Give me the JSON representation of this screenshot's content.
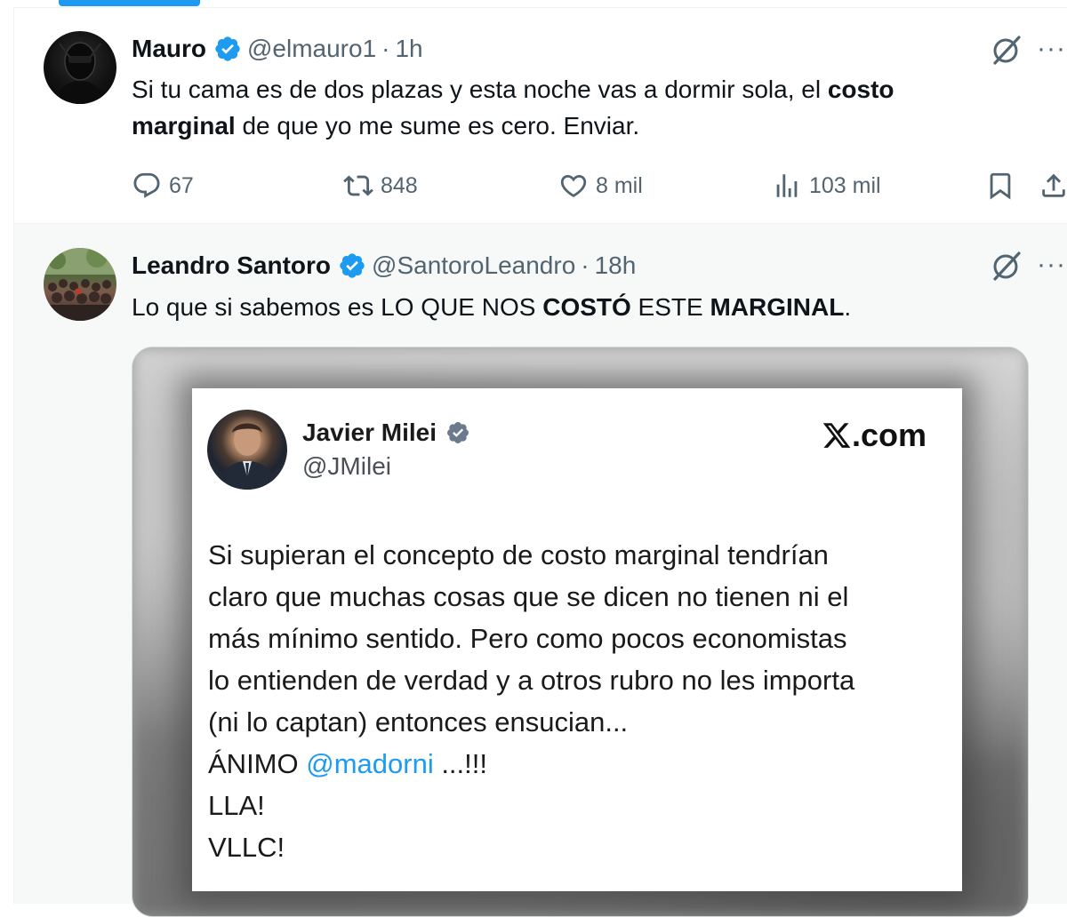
{
  "accent": "#1d9bf0",
  "tweets": [
    {
      "name": "Mauro",
      "handle": "@elmauro1",
      "time": "1h",
      "text_parts": [
        {
          "t": "Si tu cama es de dos plazas y esta noche vas a dormir sola, el ",
          "b": false
        },
        {
          "t": "costo marginal",
          "b": true
        },
        {
          "t": " de que yo me sume es cero. Enviar.",
          "b": false
        }
      ],
      "actions": {
        "replies": "67",
        "reposts": "848",
        "likes": "8 mil",
        "views": "103 mil"
      }
    },
    {
      "name": "Leandro Santoro",
      "handle": "@SantoroLeandro",
      "time": "18h",
      "text_parts": [
        {
          "t": "Lo que si sabemos es LO QUE NOS ",
          "b": false
        },
        {
          "t": "COSTÓ",
          "b": true
        },
        {
          "t": " ESTE ",
          "b": false
        },
        {
          "t": "MARGINAL",
          "b": true
        },
        {
          "t": ".",
          "b": false
        }
      ],
      "media": {
        "name": "Javier Milei",
        "handle": "@JMilei",
        "site": ".com",
        "lines": [
          "Si supieran el concepto de costo marginal tendrían",
          "claro que muchas cosas que se dicen no tienen ni el",
          "más mínimo sentido. Pero como pocos economistas",
          "lo entienden de verdad y a otros rubro no les importa",
          "(ni lo captan) entonces ensucian..."
        ],
        "animo_prefix": "ÁNIMO ",
        "mention": "@madorni",
        "animo_suffix": " ...!!!",
        "line_lla": "LLA!",
        "line_vllc": "VLLC!"
      }
    }
  ],
  "icons": {
    "verified": "verified-badge-icon",
    "grok": "grok-icon",
    "more": "more-icon",
    "reply": "reply-icon",
    "repost": "repost-icon",
    "like": "like-icon",
    "views": "views-icon",
    "bookmark": "bookmark-icon",
    "share": "share-icon"
  },
  "more_glyph": "···"
}
